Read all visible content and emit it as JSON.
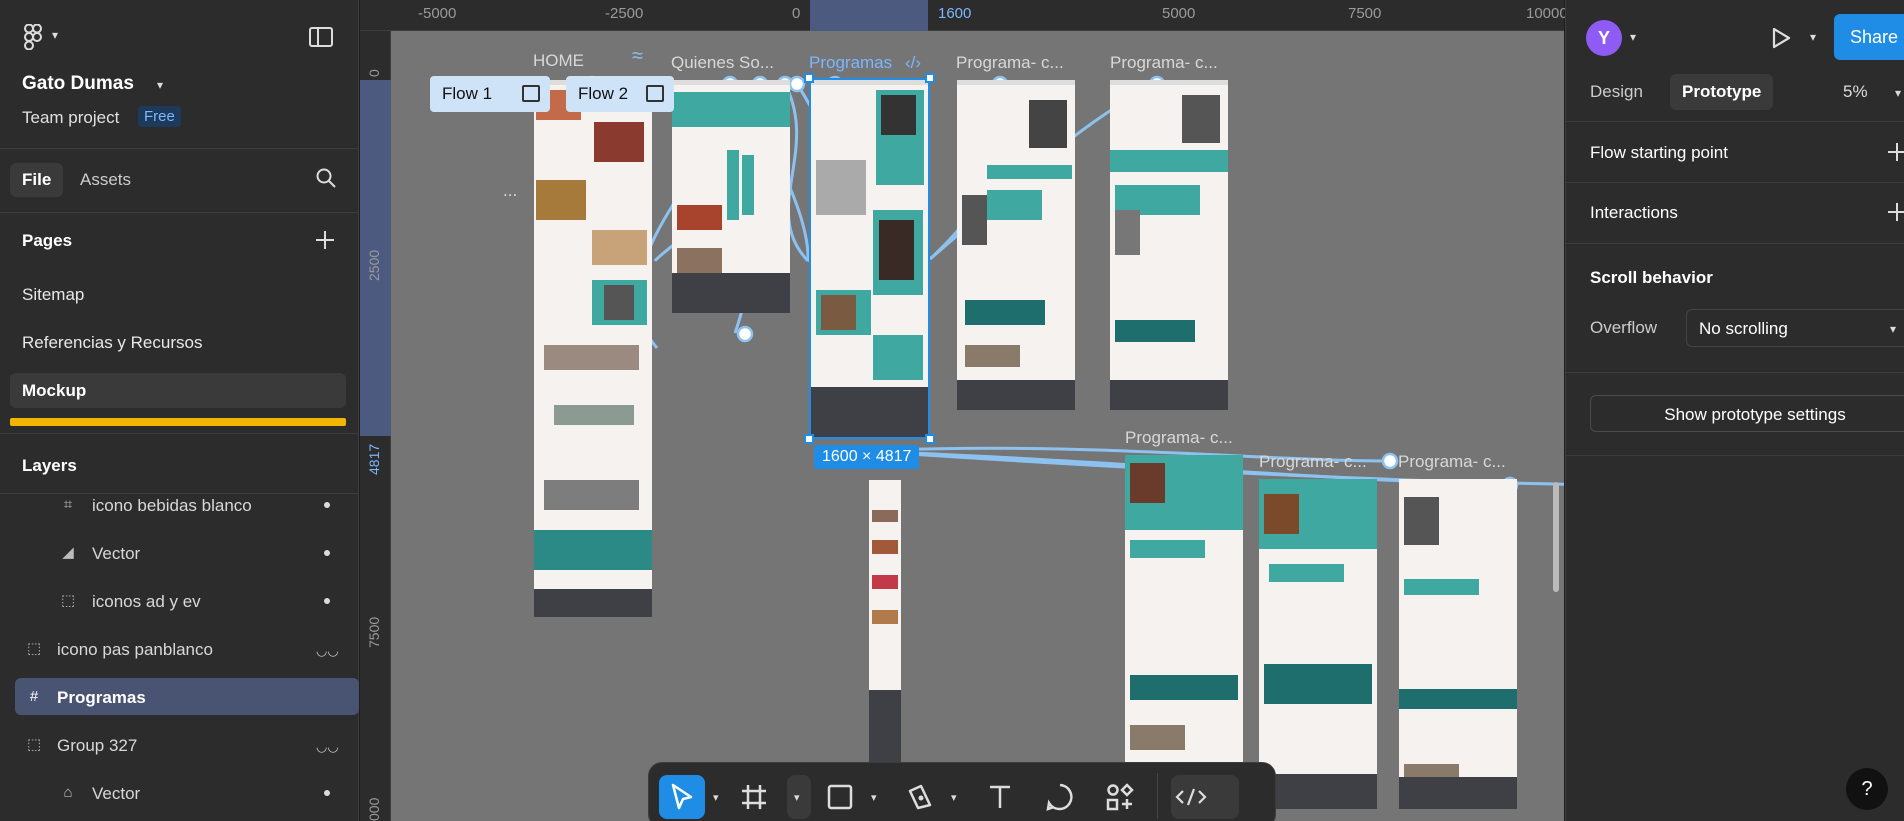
{
  "project": {
    "name": "Gato Dumas",
    "team": "Team project",
    "plan": "Free"
  },
  "left_tabs": {
    "file": "File",
    "assets": "Assets"
  },
  "pages": {
    "title": "Pages",
    "items": [
      "Sitemap",
      "Referencias y Recursos",
      "Mockup"
    ]
  },
  "layers": {
    "title": "Layers",
    "items": [
      {
        "name": "icono bebidas blanco",
        "icon": "component-icon"
      },
      {
        "name": "Vector",
        "icon": "vector-icon"
      },
      {
        "name": "iconos ad y ev",
        "icon": "group-icon"
      },
      {
        "name": "icono pas panblanco",
        "icon": "group-icon"
      },
      {
        "name": "Programas",
        "icon": "frame-icon"
      },
      {
        "name": "Group 327",
        "icon": "group-icon"
      },
      {
        "name": "Vector",
        "icon": "home-icon"
      }
    ]
  },
  "ruler": {
    "h_marks": [
      "-5000",
      "-2500",
      "0",
      "1600",
      "5000",
      "7500",
      "10000"
    ],
    "v_marks": [
      "0",
      "2500",
      "4817",
      "7500",
      "000"
    ]
  },
  "canvas": {
    "frame_labels": [
      "HOME",
      "Quienes So...",
      "Programas",
      "Programa- c...",
      "Programa- c...",
      "Programa- c...",
      "Programa- c...",
      "Programa- c..."
    ],
    "flows": [
      "Flow 1",
      "Flow 2"
    ],
    "selection_size": "1600 × 4817",
    "ellipsis": "..."
  },
  "right": {
    "avatar_letter": "Y",
    "share": "Share",
    "tabs": {
      "design": "Design",
      "prototype": "Prototype"
    },
    "zoom": "5%",
    "flow_starting_point": "Flow starting point",
    "interactions": "Interactions",
    "scroll_behavior": "Scroll behavior",
    "overflow_label": "Overflow",
    "overflow_value": "No scrolling",
    "show_proto_settings": "Show prototype settings",
    "help": "?"
  },
  "colors": {
    "accent": "#1f8de6",
    "teal": "#3fa8a0",
    "avatar": "#8e5cf5",
    "yellow": "#f2b600"
  }
}
